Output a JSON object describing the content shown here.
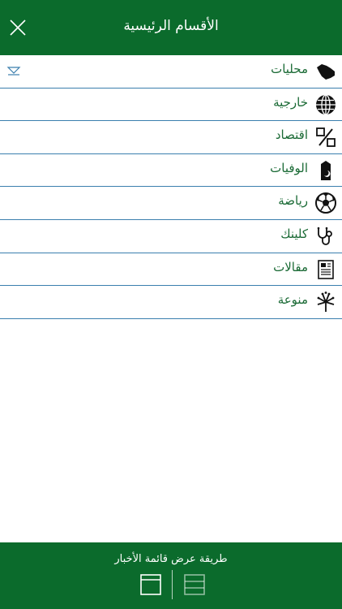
{
  "colors": {
    "brand": "#0b6b2c",
    "brand_text": "#1a6a35",
    "divider": "#3b7fae",
    "icon": "#111111",
    "expand": "#3b7fae"
  },
  "header": {
    "title": "الأقسام الرئيسية",
    "close_icon": "close-icon"
  },
  "menu": {
    "items": [
      {
        "label": "محليات",
        "icon": "saudi-map-icon",
        "expandable": true,
        "expand_icon": "chevron-down-icon"
      },
      {
        "label": "خارجية",
        "icon": "globe-icon"
      },
      {
        "label": "اقتصاد",
        "icon": "percent-icon"
      },
      {
        "label": "الوفيات",
        "icon": "obituary-icon"
      },
      {
        "label": "رياضة",
        "icon": "soccer-ball-icon"
      },
      {
        "label": "كلينك",
        "icon": "stethoscope-icon"
      },
      {
        "label": "مقالات",
        "icon": "newspaper-icon"
      },
      {
        "label": "منوعة",
        "icon": "fireworks-icon"
      }
    ]
  },
  "footer": {
    "label": "طريقة عرض  قائمة الأخبار",
    "single_view_icon": "single-view-icon",
    "list_view_icon": "list-view-icon"
  }
}
